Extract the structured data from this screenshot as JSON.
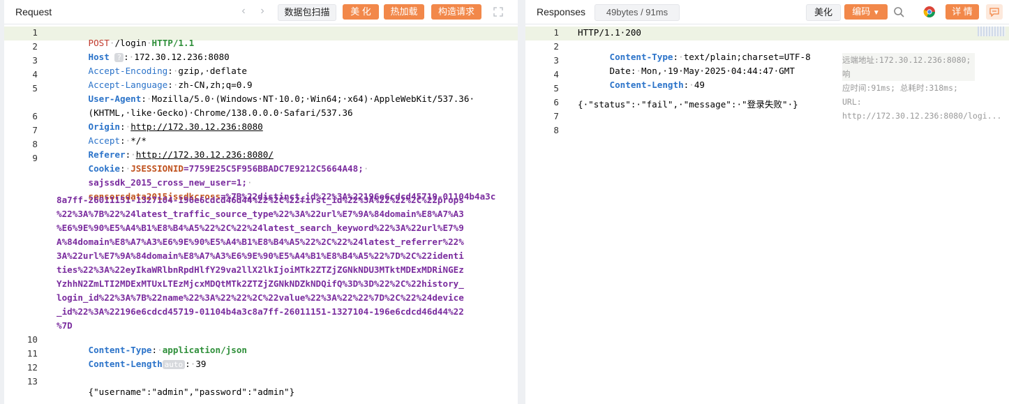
{
  "request": {
    "title": "Request",
    "buttons": {
      "scan": "数据包扫描",
      "beautify": "美 化",
      "hot_load": "热加载",
      "build": "构造请求"
    },
    "lines": [
      {
        "n": "1"
      },
      {
        "n": "2"
      },
      {
        "n": "3"
      },
      {
        "n": "4"
      },
      {
        "n": "5"
      },
      {
        "n": "6"
      },
      {
        "n": "7"
      },
      {
        "n": "8"
      },
      {
        "n": "9"
      },
      {
        "n": "10"
      },
      {
        "n": "11"
      },
      {
        "n": "12"
      },
      {
        "n": "13"
      }
    ],
    "method": "POST",
    "path": "/login",
    "version": "HTTP/1.1",
    "host_key": "Host",
    "host_badge": "?",
    "host_val": "172.30.12.236:8080",
    "enc_key": "Accept-Encoding",
    "enc_val": "gzip,·deflate",
    "lang_key": "Accept-Language",
    "lang_val": "zh-CN,zh;q=0.9",
    "ua_key": "User-Agent",
    "ua_val1": "Mozilla/5.0·(Windows·NT·10.0;·Win64;·x64)·AppleWebKit/537.36·",
    "ua_val2": "(KHTML,·like·Gecko)·Chrome/138.0.0.0·Safari/537.36",
    "origin_key": "Origin",
    "origin_val": "http://172.30.12.236:8080",
    "accept_key": "Accept",
    "accept_val": "*/*",
    "referer_key": "Referer",
    "referer_val": "http://172.30.12.236:8080/",
    "cookie_key": "Cookie",
    "cookie_jsid_name": "JSESSIONID",
    "cookie_jsid_val": "=7759E25C5F956BBADC7E9212C5664A48;",
    "cookie_sa_name": "sajssdk_2015_cross_new_user",
    "cookie_sa_val": "=1;",
    "cookie_sd_name": "sensorsdata2015jssdkcross",
    "cookie_sd_lines": [
      "=%7B%22distinct_id%22%3A%22196e6cdcd45719-01104b4a3c",
      "8a7ff-26011151-1327104-196e6cdcd46d44%22%2C%22first_id%22%3A%22%22%2C%22props",
      "%22%3A%7B%22%24latest_traffic_source_type%22%3A%22url%E7%9A%84domain%E8%A7%A3",
      "%E6%9E%90%E5%A4%B1%E8%B4%A5%22%2C%22%24latest_search_keyword%22%3A%22url%E7%9",
      "A%84domain%E8%A7%A3%E6%9E%90%E5%A4%B1%E8%B4%A5%22%2C%22%24latest_referrer%22%",
      "3A%22url%E7%9A%84domain%E8%A7%A3%E6%9E%90%E5%A4%B1%E8%B4%A5%22%7D%2C%22identi",
      "ties%22%3A%22eyIkaWRlbnRpdHlfY29va2llX2lkIjoiMTk2ZTZjZGNkNDU3MTktMDExMDRiNGEz",
      "YzhhN2ZmLTI2MDExMTUxLTEzMjcxMDQtMTk2ZTZjZGNkNDZkNDQifQ%3D%3D%22%2C%22history_",
      "login_id%22%3A%7B%22name%22%3A%22%22%2C%22value%22%3A%22%22%7D%2C%22%24device",
      "_id%22%3A%22196e6cdcd45719-01104b4a3c8a7ff-26011151-1327104-196e6cdcd46d44%22",
      "%7D"
    ],
    "ct_key": "Content-Type",
    "ct_val": "application/json",
    "cl_key": "Content-Length",
    "cl_badge": "auto",
    "cl_val": "39",
    "body_line": "{\"username\":\"admin\",\"password\":\"admin\"}"
  },
  "response": {
    "title": "Responses",
    "size_time": "49bytes / 91ms",
    "buttons": {
      "beautify": "美化",
      "encoding": "编码",
      "details": "详 情"
    },
    "lines": [
      {
        "n": "1"
      },
      {
        "n": "2"
      },
      {
        "n": "3"
      },
      {
        "n": "4"
      },
      {
        "n": "5"
      },
      {
        "n": "6"
      },
      {
        "n": "7"
      },
      {
        "n": "8"
      }
    ],
    "status_line": "HTTP/1.1·200",
    "ct_key": "Content-Type",
    "ct_val": "text/plain;charset=UTF-8",
    "date_key": "Date",
    "date_val": "Mon,·19·May·2025·04:44:47·GMT",
    "cl_key": "Content-Length",
    "cl_val": "49",
    "body_line": "{·\"status\":·\"fail\",·\"message\":·\"登录失败\"·}",
    "meta_remote": "远端地址:172.30.12.236:8080; 响",
    "meta_time": "应时间:91ms; 总耗时:318ms; URL:",
    "meta_url": "http://172.30.12.236:8080/logi..."
  },
  "colors": {
    "accent": "#f2884a",
    "highlight": "#eef3e4",
    "header_key": "#2b73c9"
  }
}
